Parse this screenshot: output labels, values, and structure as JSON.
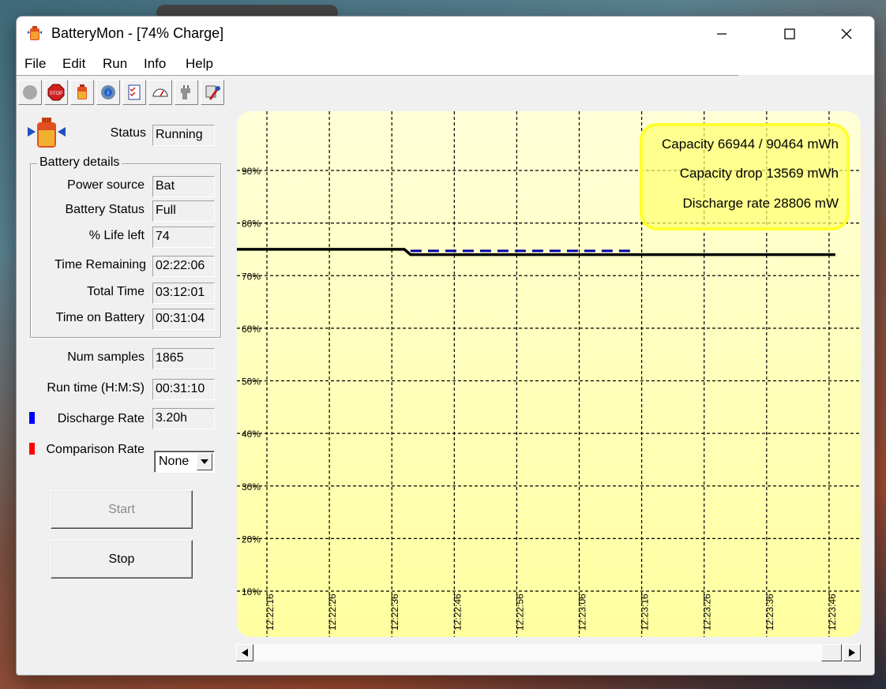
{
  "window": {
    "title": "BatteryMon - [74% Charge]"
  },
  "menu": [
    "File",
    "Edit",
    "Run",
    "Info",
    "Help"
  ],
  "toolbar_icons": [
    "record-icon",
    "stop-sign-icon",
    "battery-icon",
    "settings-info-icon",
    "checklist-icon",
    "gauge-icon",
    "plug-icon",
    "tools-icon"
  ],
  "status": {
    "label": "Status",
    "value": "Running"
  },
  "battery_details": {
    "title": "Battery details",
    "fields": [
      {
        "label": "Power source",
        "value": "Bat"
      },
      {
        "label": "Battery Status",
        "value": "Full"
      },
      {
        "label": "% Life left",
        "value": "74"
      },
      {
        "label": "Time Remaining",
        "value": "02:22:06"
      },
      {
        "label": "Total Time",
        "value": "03:12:01"
      },
      {
        "label": "Time on Battery",
        "value": "00:31:04"
      }
    ]
  },
  "samples": {
    "label": "Num samples",
    "value": "1865"
  },
  "runtime": {
    "label": "Run time (H:M:S)",
    "value": "00:31:10"
  },
  "discharge": {
    "label": "Discharge Rate",
    "value": "3.20h",
    "color": "#0000ff"
  },
  "comparison": {
    "label": "Comparison Rate",
    "selected": "None",
    "color": "#ff0000"
  },
  "buttons": {
    "start": "Start",
    "stop": "Stop"
  },
  "chart_data": {
    "type": "line",
    "background": "#ffffc0",
    "grid": true,
    "ylim": [
      0,
      100
    ],
    "yticks": [
      "90%",
      "80%",
      "70%",
      "60%",
      "50%",
      "40%",
      "30%",
      "20%",
      "10%"
    ],
    "xticks": [
      "12:22:16",
      "12:22:26",
      "12:22:36",
      "12:22:46",
      "12:22:56",
      "12:23:06",
      "12:23:16",
      "12:23:26",
      "12:23:36",
      "12:23:46"
    ],
    "series": [
      {
        "color": "#000000",
        "style": "solid",
        "points": [
          [
            "12:22:11",
            75.0
          ],
          [
            "12:22:38",
            75.0
          ],
          [
            "12:22:39",
            74.0
          ],
          [
            "12:23:47",
            74.0
          ]
        ]
      },
      {
        "color": "#0000aa",
        "style": "dashed",
        "points": [
          [
            "12:22:39",
            74.7
          ],
          [
            "12:23:15",
            74.7
          ]
        ]
      }
    ],
    "annotations": [
      "Capacity 66944 / 90464 mWh",
      "Capacity drop 13569 mWh",
      "Discharge rate 28806 mW"
    ]
  }
}
